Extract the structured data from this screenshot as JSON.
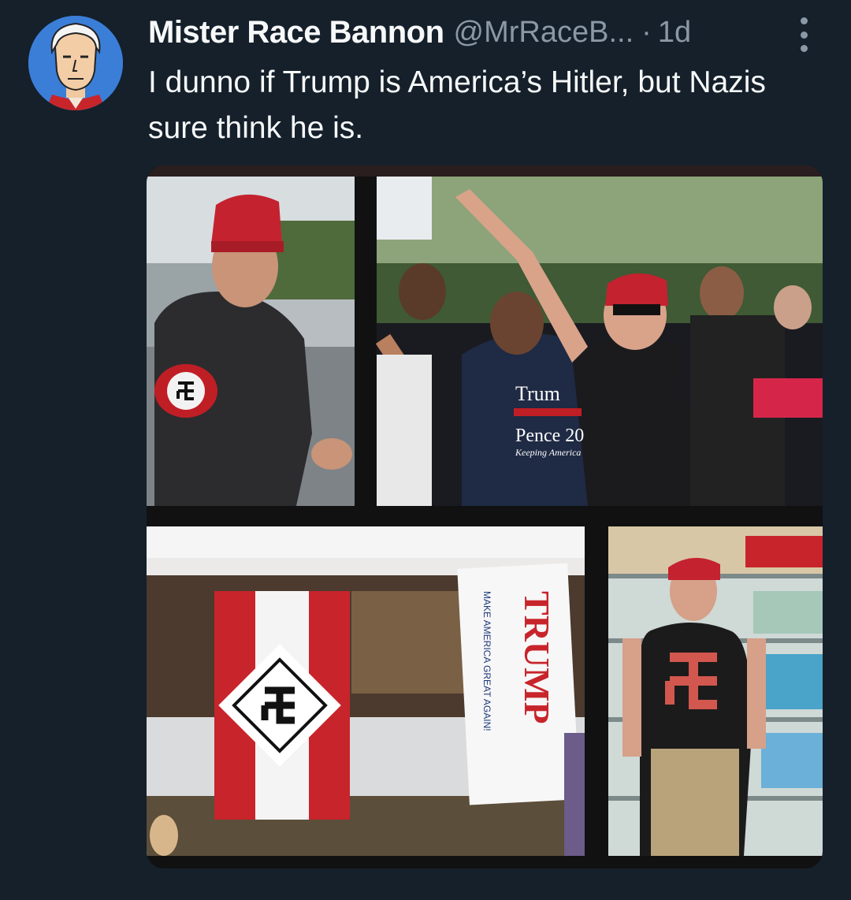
{
  "tweet": {
    "display_name": "Mister Race Bannon",
    "handle": "@MrRaceB...",
    "separator": "·",
    "time": "1d",
    "text": "I dunno if Trump is America’s Hitler, but Nazis sure think he is."
  },
  "icons": {
    "more": "more-vertical-icon",
    "avatar": "cartoon-avatar"
  },
  "media": {
    "panel_count": 4,
    "photo_text": {
      "hat_1": "MAKE AMERICA GREAT AGAIN",
      "shirt_1": "Trump",
      "shirt_2": "Pence 20",
      "shirt_3": "Keeping America",
      "banner": "TRUMP",
      "banner_sub": "MAKE AMERICA GREAT AGAIN!"
    }
  },
  "colors": {
    "background": "#15202b",
    "text_primary": "#f7f9f9",
    "text_secondary": "#8b98a5",
    "avatar_bg": "#3b7ed8"
  }
}
